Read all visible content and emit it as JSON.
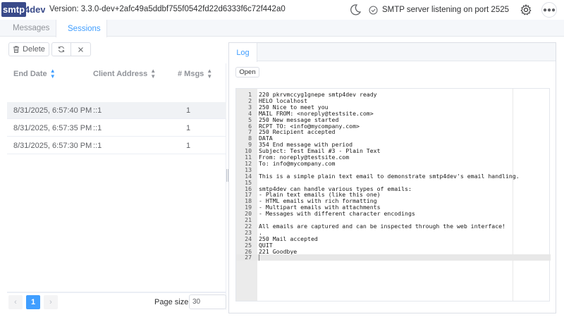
{
  "header": {
    "logo_text": "smtp4dev",
    "version": "Version: 3.3.0-dev+2afc49a5ddbf755f0542fd22d6333f6c72f442a0",
    "status": "SMTP server listening on port 2525"
  },
  "tabs": [
    {
      "label": "Messages",
      "icon": "mail-icon"
    },
    {
      "label": "Sessions",
      "icon": "monitor-icon",
      "active": true
    }
  ],
  "toolbar": {
    "delete_label": "Delete"
  },
  "table": {
    "headers": [
      "End Date",
      "Client Address",
      "# Msgs"
    ],
    "rows": [
      {
        "end_date": "8/31/2025, 6:57:40 PM",
        "client": "::1",
        "msgs": "1"
      },
      {
        "end_date": "8/31/2025, 6:57:35 PM",
        "client": "::1",
        "msgs": "1"
      },
      {
        "end_date": "8/31/2025, 6:57:30 PM",
        "client": "::1",
        "msgs": "1"
      }
    ]
  },
  "pager": {
    "current": "1",
    "page_size_label": "Page size:",
    "page_size": "30"
  },
  "log": {
    "tab_label": "Log",
    "open_label": "Open",
    "lines": [
      "220 pkrvmccyg1gnepe smtp4dev ready",
      "HELO localhost",
      "250 Nice to meet you",
      "MAIL FROM: <noreply@testsite.com>",
      "250 New message started",
      "RCPT TO: <info@mycompany.com>",
      "250 Recipient accepted",
      "DATA",
      "354 End message with period",
      "Subject: Test Email #3 - Plain Text",
      "From: noreply@testsite.com",
      "To: info@mycompany.com",
      "",
      "This is a simple plain text email to demonstrate smtp4dev's email handling.",
      "",
      "smtp4dev can handle various types of emails:",
      "- Plain text emails (like this one)",
      "- HTML emails with rich formatting",
      "- Multipart emails with attachments",
      "- Messages with different character encodings",
      "",
      "All emails are captured and can be inspected through the web interface!",
      ".",
      "250 Mail accepted",
      "QUIT",
      "221 Goodbye",
      ""
    ]
  },
  "colors": {
    "accent": "#409eff",
    "selected_row": "#f0f2f5"
  }
}
